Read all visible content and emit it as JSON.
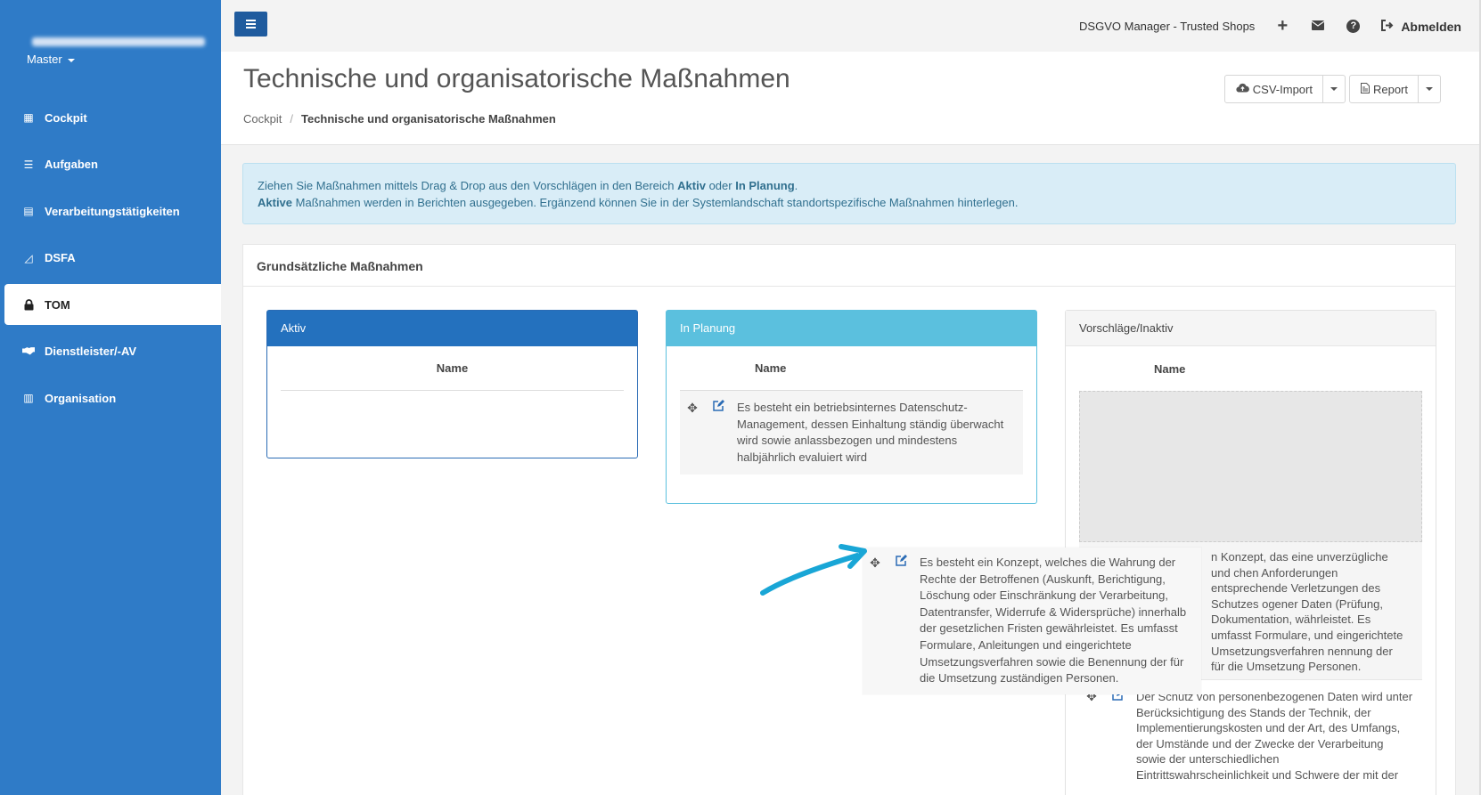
{
  "sidebar": {
    "master_label": "Master",
    "items": [
      {
        "label": "Cockpit",
        "icon": "chart-bar-icon",
        "glyph": "▦"
      },
      {
        "label": "Aufgaben",
        "icon": "list-icon",
        "glyph": "☰"
      },
      {
        "label": "Verarbeitungstätigkeiten",
        "icon": "table-icon",
        "glyph": "▤"
      },
      {
        "label": "DSFA",
        "icon": "chart-line-icon",
        "glyph": "◿"
      },
      {
        "label": "TOM",
        "icon": "lock-icon",
        "glyph": "🔒"
      },
      {
        "label": "Dienstleister/-AV",
        "icon": "handshake-icon",
        "glyph": "✋"
      },
      {
        "label": "Organisation",
        "icon": "building-icon",
        "glyph": "▥"
      }
    ]
  },
  "topbar": {
    "title": "DSGVO Manager - Trusted Shops",
    "plus_glyph": "+",
    "help_glyph": "?",
    "logout_glyph": "⇥",
    "logout_label": "Abmelden"
  },
  "header": {
    "title": "Technische und organisatorische Maßnahmen",
    "breadcrumb_home": "Cockpit",
    "breadcrumb_sep": "/",
    "breadcrumb_current": "Technische und organisatorische Maßnahmen",
    "csv_label": "CSV-Import",
    "report_label": "Report",
    "csv_glyph": "☁",
    "report_glyph": "▤"
  },
  "alert": {
    "line1_pre": "Ziehen Sie Maßnahmen mittels Drag & Drop aus den Vorschlägen in den Bereich ",
    "line1_b1": "Aktiv",
    "line1_mid": " oder ",
    "line1_b2": "In Planung",
    "line1_end": ".",
    "line2_b": "Aktive",
    "line2_rest": " Maßnahmen werden in Berichten ausgegeben. Ergänzend können Sie in der Systemlandschaft standortspezifische Maßnahmen hinterlegen."
  },
  "panel": {
    "title": "Grundsätzliche Maßnahmen",
    "column_header": "Name",
    "move_glyph": "✥",
    "edit_glyph": "✎",
    "aktiv": {
      "title": "Aktiv"
    },
    "plan": {
      "title": "In Planung",
      "rows": [
        "Es besteht ein betriebsinternes Datenschutz-Management, dessen Einhaltung ständig überwacht wird sowie anlassbezogen und mindestens halbjährlich evaluiert wird"
      ]
    },
    "vorschlaege": {
      "title": "Vorschläge/Inaktiv",
      "partial_row": "n Konzept, das eine unverzügliche und chen Anforderungen entsprechende Verletzungen des Schutzes ogener Daten (Prüfung, Dokumentation, währleistet. Es umfasst Formulare, und eingerichtete Umsetzungsverfahren nennung der für die Umsetzung Personen.",
      "next_row": "Der Schutz von personenbezogenen Daten wird unter Berücksichtigung des Stands der Technik, der Implementierungskosten und der Art, des Umfangs, der Umstände und der Zwecke der Verarbeitung sowie der unterschiedlichen Eintrittswahrscheinlichkeit und Schwere der mit der"
    },
    "dragging_row": "Es besteht ein Konzept, welches die Wahrung der Rechte der Betroffenen (Auskunft, Berichtigung, Löschung oder Einschränkung der Verarbeitung, Datentransfer, Widerrufe & Widersprüche) innerhalb der gesetzlichen Fristen gewährleistet. Es umfasst Formulare, Anleitungen und eingerichtete Umsetzungsverfahren sowie die Benennung der für die Umsetzung zuständigen Personen."
  },
  "colors": {
    "sidebar": "#2f7bc7",
    "aktiv": "#2471be",
    "plan": "#5bc0de",
    "arrow": "#19a6d6"
  }
}
